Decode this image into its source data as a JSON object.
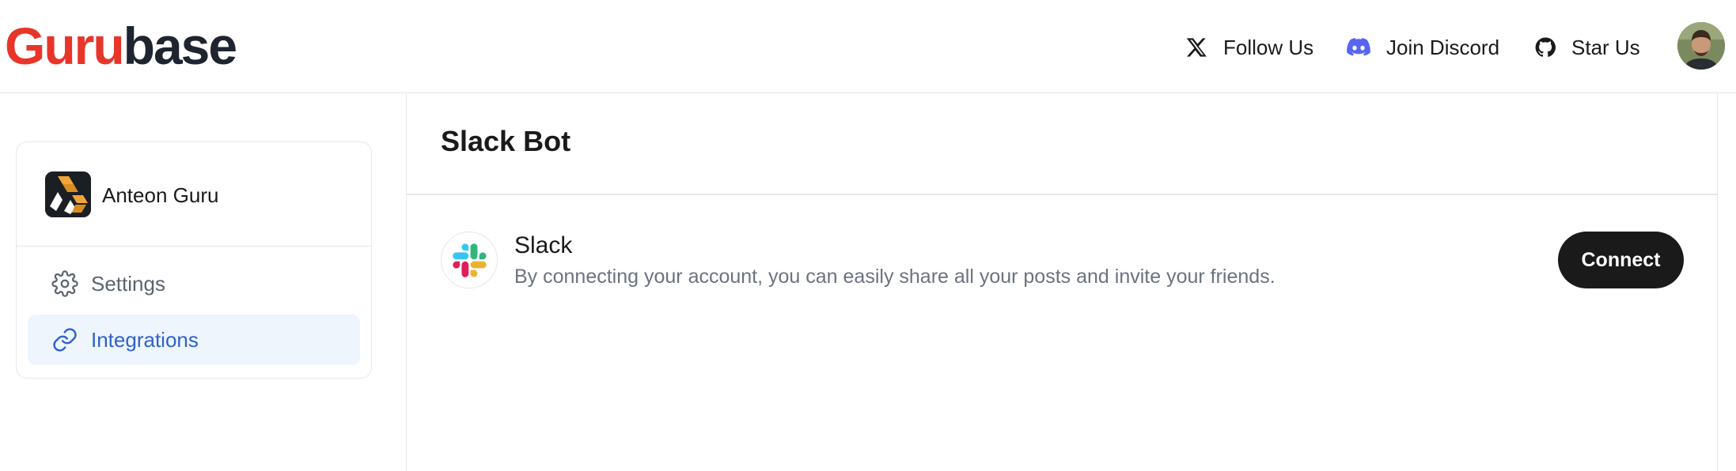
{
  "header": {
    "logo": {
      "part1": "Guru",
      "part2": "base"
    },
    "nav": {
      "follow": {
        "label": "Follow Us",
        "icon": "x-twitter-icon"
      },
      "discord": {
        "label": "Join Discord",
        "icon": "discord-icon"
      },
      "star": {
        "label": "Star Us",
        "icon": "github-icon"
      }
    },
    "avatar": "user-avatar"
  },
  "sidebar": {
    "guru_name": "Anteon Guru",
    "items": [
      {
        "label": "Settings",
        "icon": "gear-icon",
        "active": false
      },
      {
        "label": "Integrations",
        "icon": "link-icon",
        "active": true
      }
    ]
  },
  "main": {
    "title": "Slack Bot",
    "integration": {
      "name": "Slack",
      "description": "By connecting your account, you can easily share all your posts and invite your friends.",
      "button_label": "Connect",
      "icon": "slack-icon"
    }
  },
  "colors": {
    "logo_guru": "#e8352a",
    "logo_base": "#1e2530",
    "active_item_bg": "#eef5fd",
    "active_item_text": "#2f62c9",
    "discord_blurple": "#5865f2",
    "button_bg": "#1a1a1a"
  }
}
